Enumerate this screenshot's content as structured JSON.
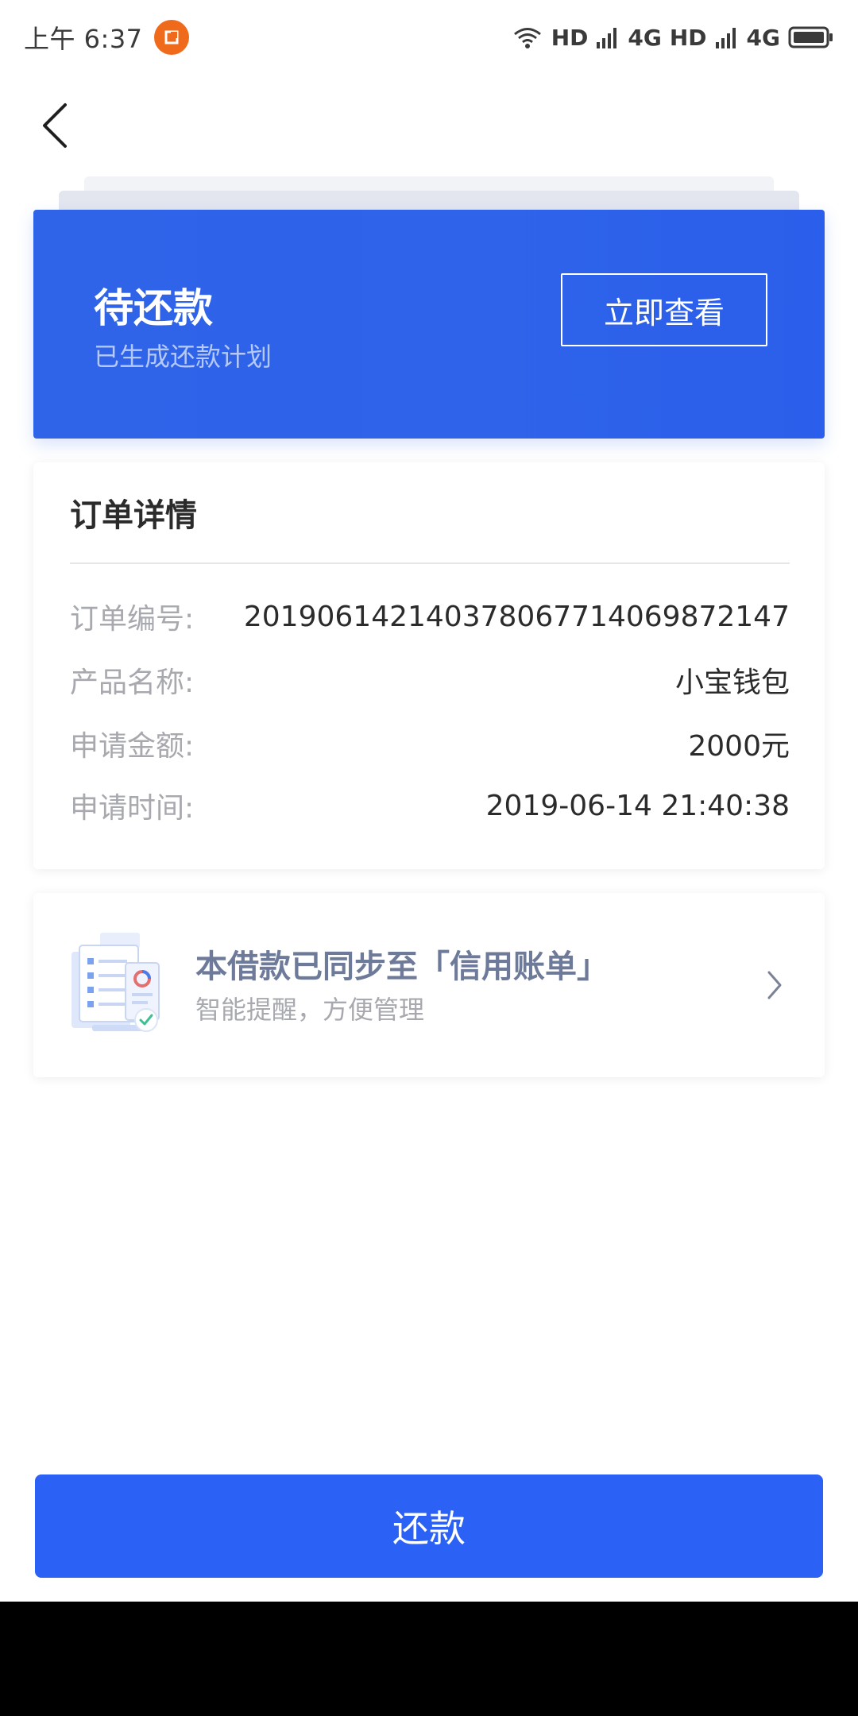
{
  "status_bar": {
    "time": "上午 6:37",
    "network_1": "HD",
    "network_1_type": "4G",
    "network_2": "HD",
    "network_2_type": "4G"
  },
  "status_card": {
    "title": "待还款",
    "subtitle": "已生成还款计划",
    "view_button": "立即查看"
  },
  "order": {
    "heading": "订单详情",
    "rows": [
      {
        "label": "订单编号:",
        "value": "201906142140378067714069872147"
      },
      {
        "label": "产品名称:",
        "value": "小宝钱包"
      },
      {
        "label": "申请金额:",
        "value": "2000元"
      },
      {
        "label": "申请时间:",
        "value": "2019-06-14 21:40:38"
      }
    ]
  },
  "sync": {
    "title": "本借款已同步至「信用账单」",
    "subtitle": "智能提醒，方便管理"
  },
  "repay_button": "还款",
  "icons": {
    "back": "back-arrow-icon",
    "chevron": "chevron-right-icon",
    "wifi": "wifi-icon",
    "signal": "signal-icon",
    "battery": "battery-icon",
    "notification": "app-notification-icon",
    "illustration": "credit-bill-illustration"
  },
  "colors": {
    "primary": "#2b61f5",
    "status_card": "#2f63e8",
    "label_gray": "#a7a9ae",
    "text_dark": "#2b2b2b",
    "sync_title": "#6e7a99"
  }
}
